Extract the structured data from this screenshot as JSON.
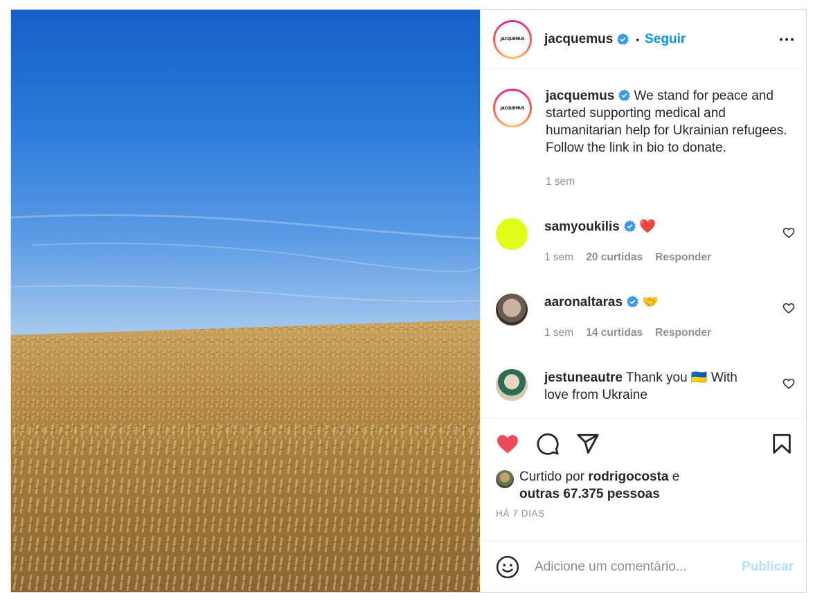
{
  "post": {
    "author": "jacquemus",
    "author_logo_text": "JACQUEMUS",
    "follow_label": "Seguir",
    "separator": "•"
  },
  "caption": {
    "username": "jacquemus",
    "text": "We stand for peace and started supporting medical and humanitarian help for Ukrainian refugees.",
    "text2": "Follow the link in bio to donate.",
    "time": "1 sem"
  },
  "comments": [
    {
      "username": "samyoukilis",
      "verified": true,
      "text": "❤️",
      "time": "1 sem",
      "likes": "20 curtidas",
      "reply": "Responder",
      "avatar_color": "#dfff1a"
    },
    {
      "username": "aaronaltaras",
      "verified": true,
      "text": "🤝",
      "time": "1 sem",
      "likes": "14 curtidas",
      "reply": "Responder",
      "avatar_color": "#b9a79a"
    },
    {
      "username": "jestuneautre",
      "verified": false,
      "text": "Thank you 🇺🇦 With love from Ukraine",
      "time": "",
      "likes": "",
      "reply": "",
      "avatar_color": "#d8c9b5"
    }
  ],
  "likes": {
    "prefix": "Curtido por",
    "user": "rodrigocosta",
    "conj": "e",
    "others": "outras 67.375 pessoas"
  },
  "date": "HÁ 7 DIAS",
  "add_comment": {
    "placeholder": "Adicione um comentário...",
    "publish_label": "Publicar"
  },
  "colors": {
    "accent": "#0095f6",
    "verified": "#3897f0",
    "like_red": "#ed4956",
    "muted": "#8e8e8e"
  },
  "icons": [
    "verified-icon",
    "more-icon",
    "heart-icon",
    "comment-icon",
    "share-icon",
    "bookmark-icon",
    "emoji-icon"
  ]
}
